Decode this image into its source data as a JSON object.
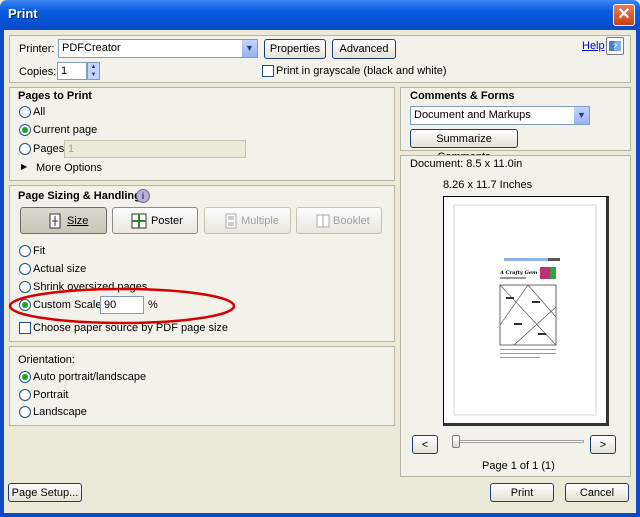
{
  "window": {
    "title": "Print",
    "close_glyph": "✕"
  },
  "header": {
    "printer_label": "Printer:",
    "printer_value": "PDFCreator",
    "properties_label": "Properties",
    "advanced_label": "Advanced",
    "help_label": "Help",
    "copies_label": "Copies:",
    "copies_value": "1",
    "grayscale_label": "Print in grayscale (black and white)",
    "grayscale_checked": false
  },
  "pages_to_print": {
    "title": "Pages to Print",
    "all_label": "All",
    "current_label": "Current page",
    "pages_label": "Pages",
    "pages_value": "1",
    "more_options_label": "More Options",
    "selected": "current"
  },
  "page_sizing": {
    "title": "Page Sizing & Handling",
    "info_glyph": "i",
    "modes": [
      {
        "label": "Size",
        "icon": "size-icon",
        "state": "active"
      },
      {
        "label": "Poster",
        "icon": "poster-icon",
        "state": "enabled"
      },
      {
        "label": "Multiple",
        "icon": "multiple-icon",
        "state": "disabled"
      },
      {
        "label": "Booklet",
        "icon": "booklet-icon",
        "state": "disabled"
      }
    ],
    "fit_label": "Fit",
    "actual_label": "Actual size",
    "shrink_label": "Shrink oversized pages",
    "custom_label": "Custom Scale:",
    "custom_value": "90",
    "custom_unit": "%",
    "selected": "custom",
    "paper_source_label": "Choose paper source by PDF page size",
    "highlight_color": "#d40000"
  },
  "orientation": {
    "title": "Orientation:",
    "auto_label": "Auto portrait/landscape",
    "portrait_label": "Portrait",
    "landscape_label": "Landscape",
    "selected": "auto"
  },
  "comments_forms": {
    "title": "Comments & Forms",
    "select_value": "Document and Markups",
    "summarize_label": "Summarize Comments"
  },
  "preview": {
    "document_size": "Document: 8.5 x 11.0in",
    "paper_size": "8.26 x 11.7 Inches",
    "prev_glyph": "<",
    "next_glyph": ">",
    "page_info": "Page 1 of 1 (1)",
    "zoom_fraction": 0.0
  },
  "footer": {
    "page_setup_label": "Page Setup...",
    "print_label": "Print",
    "cancel_label": "Cancel"
  }
}
